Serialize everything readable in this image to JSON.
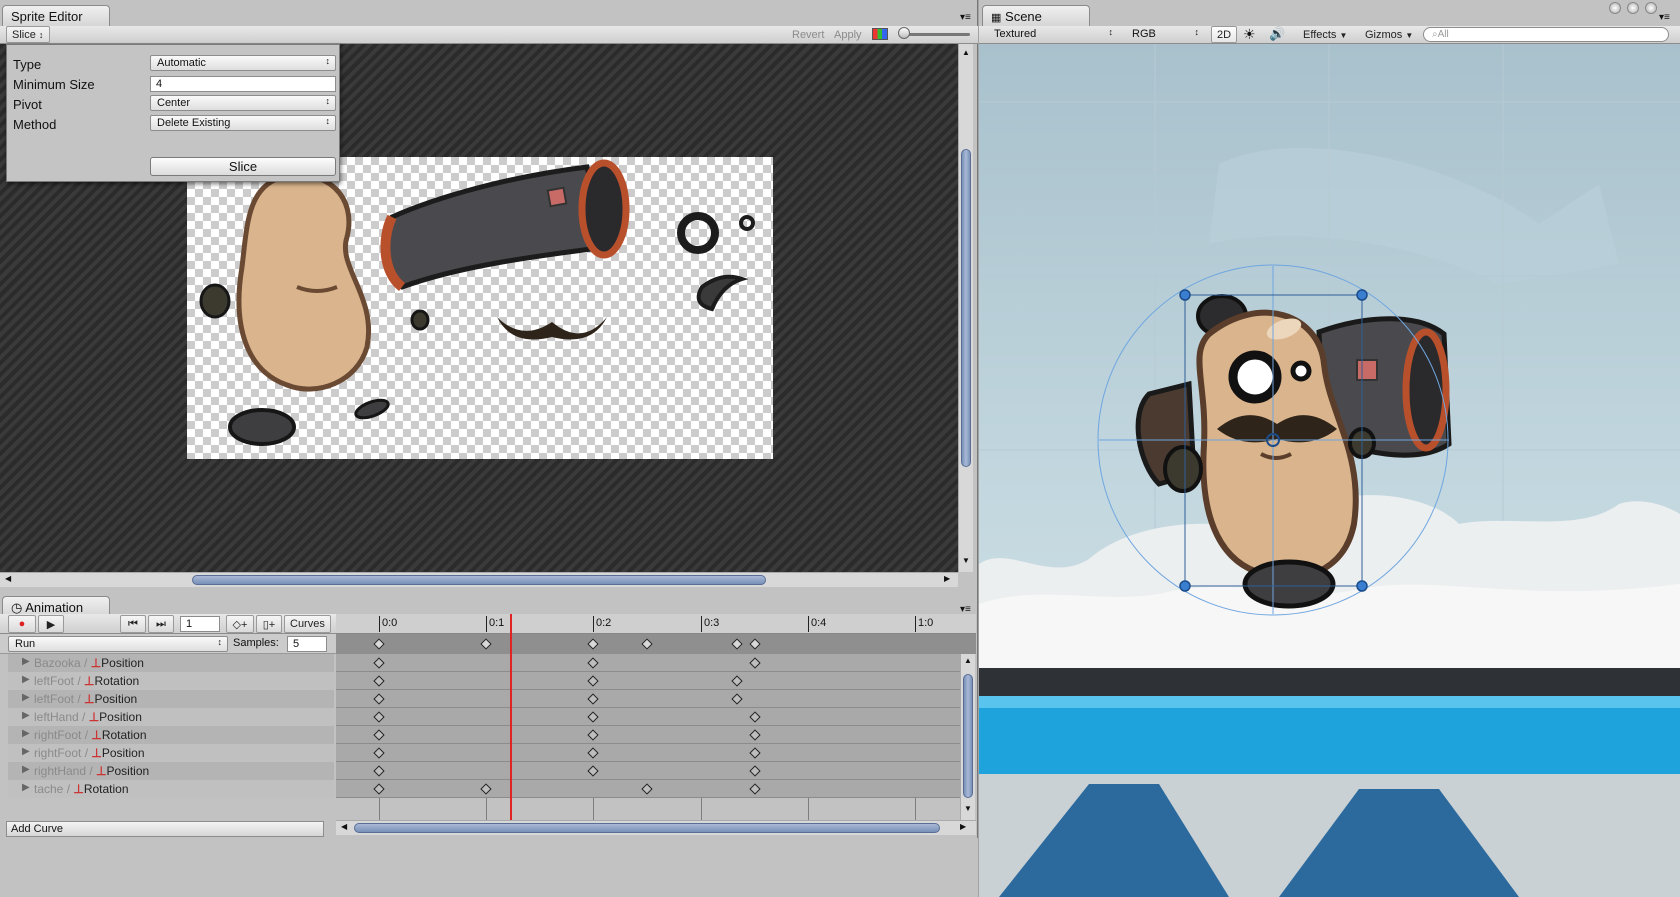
{
  "sprite_editor": {
    "tab_title": "Sprite Editor",
    "slice_menu": "Slice",
    "revert_label": "Revert",
    "apply_label": "Apply",
    "slice_panel": {
      "type_label": "Type",
      "type_value": "Automatic",
      "min_size_label": "Minimum Size",
      "min_size_value": "4",
      "pivot_label": "Pivot",
      "pivot_value": "Center",
      "method_label": "Method",
      "method_value": "Delete Existing",
      "slice_button": "Slice"
    }
  },
  "scene": {
    "tab_title": "Scene",
    "shading_mode": "Textured",
    "render_mode": "RGB",
    "mode_2d": "2D",
    "effects_label": "Effects",
    "gizmos_label": "Gizmos",
    "search_placeholder": "All"
  },
  "animation": {
    "tab_title": "Animation",
    "frame_value": "1",
    "curves_label": "Curves",
    "clip_name": "Run",
    "samples_label": "Samples:",
    "samples_value": "5",
    "add_curve_label": "Add Curve",
    "time_labels": [
      "0:0",
      "0:1",
      "0:2",
      "0:3",
      "0:4",
      "1:0"
    ],
    "tracks": [
      {
        "object": "Bazooka /",
        "property": "Position"
      },
      {
        "object": "leftFoot /",
        "property": "Rotation"
      },
      {
        "object": "leftFoot /",
        "property": "Position"
      },
      {
        "object": "leftHand /",
        "property": "Position"
      },
      {
        "object": "rightFoot /",
        "property": "Rotation"
      },
      {
        "object": "rightFoot /",
        "property": "Position"
      },
      {
        "object": "rightHand /",
        "property": "Position"
      },
      {
        "object": "tache /",
        "property": "Rotation"
      }
    ]
  }
}
